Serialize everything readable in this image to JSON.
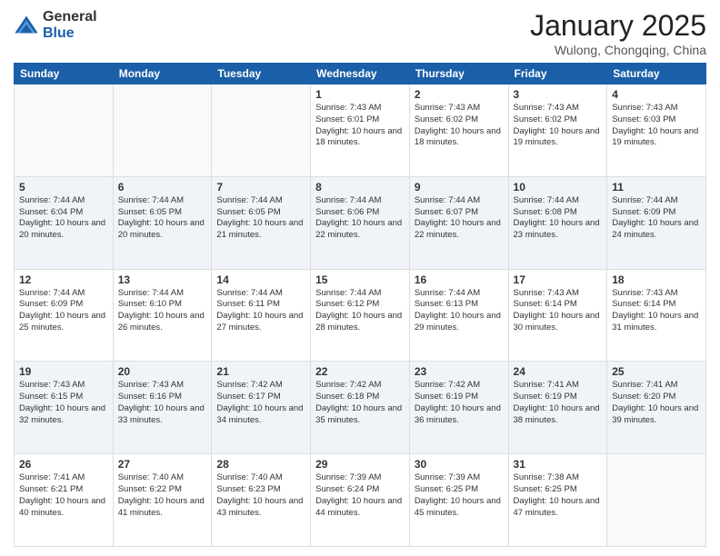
{
  "logo": {
    "general": "General",
    "blue": "Blue"
  },
  "header": {
    "title": "January 2025",
    "location": "Wulong, Chongqing, China"
  },
  "days_of_week": [
    "Sunday",
    "Monday",
    "Tuesday",
    "Wednesday",
    "Thursday",
    "Friday",
    "Saturday"
  ],
  "weeks": [
    [
      {
        "day": "",
        "info": ""
      },
      {
        "day": "",
        "info": ""
      },
      {
        "day": "",
        "info": ""
      },
      {
        "day": "1",
        "info": "Sunrise: 7:43 AM\nSunset: 6:01 PM\nDaylight: 10 hours and 18 minutes."
      },
      {
        "day": "2",
        "info": "Sunrise: 7:43 AM\nSunset: 6:02 PM\nDaylight: 10 hours and 18 minutes."
      },
      {
        "day": "3",
        "info": "Sunrise: 7:43 AM\nSunset: 6:02 PM\nDaylight: 10 hours and 19 minutes."
      },
      {
        "day": "4",
        "info": "Sunrise: 7:43 AM\nSunset: 6:03 PM\nDaylight: 10 hours and 19 minutes."
      }
    ],
    [
      {
        "day": "5",
        "info": "Sunrise: 7:44 AM\nSunset: 6:04 PM\nDaylight: 10 hours and 20 minutes."
      },
      {
        "day": "6",
        "info": "Sunrise: 7:44 AM\nSunset: 6:05 PM\nDaylight: 10 hours and 20 minutes."
      },
      {
        "day": "7",
        "info": "Sunrise: 7:44 AM\nSunset: 6:05 PM\nDaylight: 10 hours and 21 minutes."
      },
      {
        "day": "8",
        "info": "Sunrise: 7:44 AM\nSunset: 6:06 PM\nDaylight: 10 hours and 22 minutes."
      },
      {
        "day": "9",
        "info": "Sunrise: 7:44 AM\nSunset: 6:07 PM\nDaylight: 10 hours and 22 minutes."
      },
      {
        "day": "10",
        "info": "Sunrise: 7:44 AM\nSunset: 6:08 PM\nDaylight: 10 hours and 23 minutes."
      },
      {
        "day": "11",
        "info": "Sunrise: 7:44 AM\nSunset: 6:09 PM\nDaylight: 10 hours and 24 minutes."
      }
    ],
    [
      {
        "day": "12",
        "info": "Sunrise: 7:44 AM\nSunset: 6:09 PM\nDaylight: 10 hours and 25 minutes."
      },
      {
        "day": "13",
        "info": "Sunrise: 7:44 AM\nSunset: 6:10 PM\nDaylight: 10 hours and 26 minutes."
      },
      {
        "day": "14",
        "info": "Sunrise: 7:44 AM\nSunset: 6:11 PM\nDaylight: 10 hours and 27 minutes."
      },
      {
        "day": "15",
        "info": "Sunrise: 7:44 AM\nSunset: 6:12 PM\nDaylight: 10 hours and 28 minutes."
      },
      {
        "day": "16",
        "info": "Sunrise: 7:44 AM\nSunset: 6:13 PM\nDaylight: 10 hours and 29 minutes."
      },
      {
        "day": "17",
        "info": "Sunrise: 7:43 AM\nSunset: 6:14 PM\nDaylight: 10 hours and 30 minutes."
      },
      {
        "day": "18",
        "info": "Sunrise: 7:43 AM\nSunset: 6:14 PM\nDaylight: 10 hours and 31 minutes."
      }
    ],
    [
      {
        "day": "19",
        "info": "Sunrise: 7:43 AM\nSunset: 6:15 PM\nDaylight: 10 hours and 32 minutes."
      },
      {
        "day": "20",
        "info": "Sunrise: 7:43 AM\nSunset: 6:16 PM\nDaylight: 10 hours and 33 minutes."
      },
      {
        "day": "21",
        "info": "Sunrise: 7:42 AM\nSunset: 6:17 PM\nDaylight: 10 hours and 34 minutes."
      },
      {
        "day": "22",
        "info": "Sunrise: 7:42 AM\nSunset: 6:18 PM\nDaylight: 10 hours and 35 minutes."
      },
      {
        "day": "23",
        "info": "Sunrise: 7:42 AM\nSunset: 6:19 PM\nDaylight: 10 hours and 36 minutes."
      },
      {
        "day": "24",
        "info": "Sunrise: 7:41 AM\nSunset: 6:19 PM\nDaylight: 10 hours and 38 minutes."
      },
      {
        "day": "25",
        "info": "Sunrise: 7:41 AM\nSunset: 6:20 PM\nDaylight: 10 hours and 39 minutes."
      }
    ],
    [
      {
        "day": "26",
        "info": "Sunrise: 7:41 AM\nSunset: 6:21 PM\nDaylight: 10 hours and 40 minutes."
      },
      {
        "day": "27",
        "info": "Sunrise: 7:40 AM\nSunset: 6:22 PM\nDaylight: 10 hours and 41 minutes."
      },
      {
        "day": "28",
        "info": "Sunrise: 7:40 AM\nSunset: 6:23 PM\nDaylight: 10 hours and 43 minutes."
      },
      {
        "day": "29",
        "info": "Sunrise: 7:39 AM\nSunset: 6:24 PM\nDaylight: 10 hours and 44 minutes."
      },
      {
        "day": "30",
        "info": "Sunrise: 7:39 AM\nSunset: 6:25 PM\nDaylight: 10 hours and 45 minutes."
      },
      {
        "day": "31",
        "info": "Sunrise: 7:38 AM\nSunset: 6:25 PM\nDaylight: 10 hours and 47 minutes."
      },
      {
        "day": "",
        "info": ""
      }
    ]
  ]
}
